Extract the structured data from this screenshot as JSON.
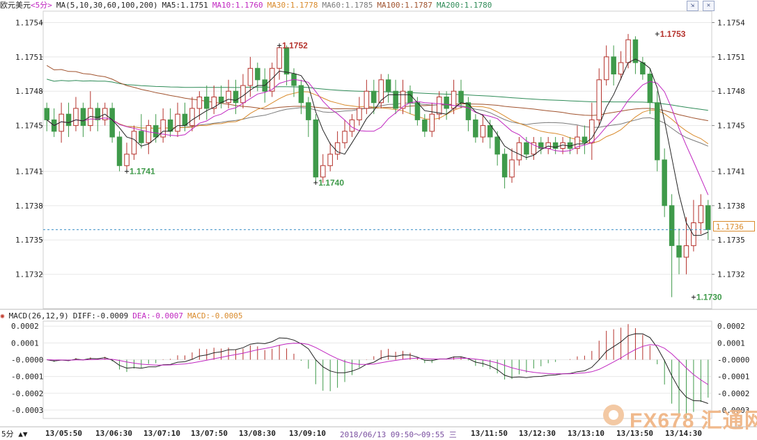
{
  "header": {
    "symbol": "欧元美元",
    "period_tag": "<5分>",
    "ma_label": "MA(5,10,30,60,100,200)",
    "ma_values": [
      {
        "text": "MA5:1.1751",
        "color": "#222222"
      },
      {
        "text": "MA10:1.1760",
        "color": "#c026c0"
      },
      {
        "text": "MA30:1.1778",
        "color": "#d98a2b"
      },
      {
        "text": "MA60:1.1785",
        "color": "#7a7a7a"
      },
      {
        "text": "MA100:1.1787",
        "color": "#a0522d"
      },
      {
        "text": "MA200:1.1780",
        "color": "#2e8b57"
      }
    ]
  },
  "macd_header": {
    "label": "MACD(26,12,9)",
    "diff": "DIFF:-0.0009",
    "dea": "DEA:-0.0007",
    "macd": "MACD:-0.0005"
  },
  "period_label": "5分",
  "last_price_label": "1.1736",
  "bottom_note": "2018/06/13 09:50～09:55 三",
  "watermark": "FX678 汇通网",
  "colors": {
    "up": "#b5322c",
    "down": "#3f9a4a",
    "ma5": "#222222",
    "ma10": "#c026c0",
    "ma30": "#d98a2b",
    "ma60": "#7a7a7a",
    "ma100": "#a0522d",
    "ma200": "#2e8b57",
    "dea": "#c026c0",
    "grid": "#e8e8e8",
    "dashed": "#3a8fc6"
  },
  "chart_data": {
    "type": "candlestick",
    "price_axis": {
      "min": 1.1729,
      "max": 1.1755,
      "ticks": [
        "1.1754",
        "1.1751",
        "1.1748",
        "1.1745",
        "1.1741",
        "1.1738",
        "1.1735",
        "1.1732"
      ]
    },
    "macd_axis": {
      "min": -0.00035,
      "max": 0.00023,
      "ticks": [
        "0.0002",
        "0.0001",
        "-0.0000",
        "-0.0001",
        "-0.0002",
        "-0.0003"
      ]
    },
    "x_labels": [
      "13/05:50",
      "13/06:30",
      "13/07:10",
      "13/07:50",
      "13/08:30",
      "13/09:10",
      "13/11:50",
      "13/12:30",
      "13/13:10",
      "13/13:50",
      "13/14:30"
    ],
    "annotations": [
      {
        "text": "1.1752",
        "price": 1.1752,
        "bar": 32,
        "type": "high"
      },
      {
        "text": "1.1741",
        "price": 1.1741,
        "bar": 11,
        "type": "low"
      },
      {
        "text": "1.1740",
        "price": 1.174,
        "bar": 37,
        "type": "low"
      },
      {
        "text": "1.1753",
        "price": 1.1753,
        "bar": 84,
        "type": "high"
      },
      {
        "text": "1.1730",
        "price": 1.173,
        "bar": 89,
        "type": "low"
      }
    ],
    "last_price": 1.17359,
    "candles": [
      [
        1.17465,
        1.17455,
        1.1747,
        1.17445
      ],
      [
        1.17455,
        1.17445,
        1.17465,
        1.1744
      ],
      [
        1.17445,
        1.1746,
        1.1747,
        1.17435
      ],
      [
        1.1746,
        1.1745,
        1.1747,
        1.1744
      ],
      [
        1.1745,
        1.17465,
        1.17475,
        1.17445
      ],
      [
        1.17465,
        1.1745,
        1.1747,
        1.1744
      ],
      [
        1.1745,
        1.17465,
        1.1748,
        1.17445
      ],
      [
        1.17465,
        1.17455,
        1.1747,
        1.17445
      ],
      [
        1.17455,
        1.17465,
        1.1747,
        1.1745
      ],
      [
        1.17465,
        1.1744,
        1.1747,
        1.17435
      ],
      [
        1.1744,
        1.17415,
        1.17445,
        1.1741
      ],
      [
        1.17415,
        1.17425,
        1.17435,
        1.1741
      ],
      [
        1.17425,
        1.17445,
        1.1745,
        1.1742
      ],
      [
        1.17445,
        1.17435,
        1.1746,
        1.1743
      ],
      [
        1.17435,
        1.1745,
        1.17455,
        1.17425
      ],
      [
        1.1745,
        1.1744,
        1.1746,
        1.17435
      ],
      [
        1.1744,
        1.17455,
        1.17465,
        1.17435
      ],
      [
        1.17455,
        1.17445,
        1.17465,
        1.1744
      ],
      [
        1.17445,
        1.1746,
        1.1747,
        1.1744
      ],
      [
        1.1746,
        1.1745,
        1.1747,
        1.17445
      ],
      [
        1.1745,
        1.17465,
        1.17475,
        1.17445
      ],
      [
        1.17465,
        1.17475,
        1.1748,
        1.17455
      ],
      [
        1.17475,
        1.17465,
        1.17485,
        1.17455
      ],
      [
        1.17465,
        1.17475,
        1.17485,
        1.1746
      ],
      [
        1.17475,
        1.1747,
        1.17485,
        1.17465
      ],
      [
        1.1747,
        1.1748,
        1.1749,
        1.17465
      ],
      [
        1.1748,
        1.1747,
        1.1749,
        1.1746
      ],
      [
        1.1747,
        1.17485,
        1.17495,
        1.17465
      ],
      [
        1.17485,
        1.175,
        1.1751,
        1.17475
      ],
      [
        1.175,
        1.1749,
        1.17505,
        1.1748
      ],
      [
        1.1749,
        1.1748,
        1.175,
        1.1747
      ],
      [
        1.1748,
        1.175,
        1.17505,
        1.17475
      ],
      [
        1.175,
        1.17518,
        1.1752,
        1.1749
      ],
      [
        1.17518,
        1.17495,
        1.1752,
        1.17485
      ],
      [
        1.17495,
        1.17485,
        1.175,
        1.17475
      ],
      [
        1.17485,
        1.1747,
        1.1749,
        1.1746
      ],
      [
        1.1747,
        1.17455,
        1.17475,
        1.1744
      ],
      [
        1.17455,
        1.17405,
        1.1746,
        1.174
      ],
      [
        1.17405,
        1.17415,
        1.17425,
        1.174
      ],
      [
        1.17415,
        1.17425,
        1.17435,
        1.1741
      ],
      [
        1.17425,
        1.17435,
        1.17445,
        1.1742
      ],
      [
        1.17435,
        1.17445,
        1.17455,
        1.1743
      ],
      [
        1.17445,
        1.17455,
        1.1746,
        1.1744
      ],
      [
        1.17455,
        1.17465,
        1.17475,
        1.1745
      ],
      [
        1.17465,
        1.1748,
        1.1749,
        1.1746
      ],
      [
        1.1748,
        1.1747,
        1.1749,
        1.1746
      ],
      [
        1.1747,
        1.1749,
        1.17495,
        1.17465
      ],
      [
        1.1749,
        1.1748,
        1.17495,
        1.1747
      ],
      [
        1.1748,
        1.17465,
        1.1749,
        1.1746
      ],
      [
        1.17465,
        1.1748,
        1.1749,
        1.1746
      ],
      [
        1.1748,
        1.1747,
        1.17485,
        1.1746
      ],
      [
        1.1747,
        1.17455,
        1.17475,
        1.1745
      ],
      [
        1.17455,
        1.17445,
        1.1746,
        1.1744
      ],
      [
        1.17445,
        1.1746,
        1.1747,
        1.1744
      ],
      [
        1.1746,
        1.17475,
        1.1748,
        1.17455
      ],
      [
        1.17475,
        1.17465,
        1.1748,
        1.17455
      ],
      [
        1.17465,
        1.1748,
        1.1749,
        1.1746
      ],
      [
        1.1748,
        1.1747,
        1.1749,
        1.17465
      ],
      [
        1.1747,
        1.17455,
        1.17475,
        1.17445
      ],
      [
        1.17455,
        1.1744,
        1.1746,
        1.17435
      ],
      [
        1.1744,
        1.1745,
        1.1746,
        1.17435
      ],
      [
        1.1745,
        1.1744,
        1.17455,
        1.1743
      ],
      [
        1.1744,
        1.17425,
        1.17445,
        1.17415
      ],
      [
        1.17425,
        1.17405,
        1.1743,
        1.17395
      ],
      [
        1.17405,
        1.1742,
        1.1743,
        1.174
      ],
      [
        1.1742,
        1.17435,
        1.1744,
        1.17415
      ],
      [
        1.17435,
        1.17425,
        1.1744,
        1.1742
      ],
      [
        1.17425,
        1.17435,
        1.1744,
        1.1742
      ],
      [
        1.17435,
        1.1743,
        1.1744,
        1.17425
      ],
      [
        1.1743,
        1.17435,
        1.1744,
        1.17425
      ],
      [
        1.17435,
        1.1743,
        1.1744,
        1.17425
      ],
      [
        1.1743,
        1.17435,
        1.1744,
        1.17425
      ],
      [
        1.17435,
        1.1743,
        1.1744,
        1.17425
      ],
      [
        1.1743,
        1.1744,
        1.1745,
        1.17425
      ],
      [
        1.1744,
        1.17435,
        1.1745,
        1.17425
      ],
      [
        1.17435,
        1.17455,
        1.1747,
        1.1742
      ],
      [
        1.17455,
        1.1749,
        1.175,
        1.1745
      ],
      [
        1.1749,
        1.1751,
        1.1752,
        1.17485
      ],
      [
        1.1751,
        1.17495,
        1.1752,
        1.17485
      ],
      [
        1.17495,
        1.17505,
        1.17515,
        1.1749
      ],
      [
        1.17505,
        1.17525,
        1.1753,
        1.175
      ],
      [
        1.17525,
        1.17505,
        1.17528,
        1.17495
      ],
      [
        1.17505,
        1.17495,
        1.1751,
        1.1749
      ],
      [
        1.17495,
        1.1747,
        1.175,
        1.1746
      ],
      [
        1.1747,
        1.1742,
        1.1748,
        1.1741
      ],
      [
        1.1742,
        1.1738,
        1.1743,
        1.1737
      ],
      [
        1.1738,
        1.17345,
        1.1739,
        1.173
      ],
      [
        1.17345,
        1.17335,
        1.1736,
        1.1732
      ],
      [
        1.17335,
        1.17345,
        1.1737,
        1.1732
      ],
      [
        1.17345,
        1.17365,
        1.17385,
        1.1734
      ],
      [
        1.17365,
        1.1738,
        1.1739,
        1.17355
      ],
      [
        1.1738,
        1.17359,
        1.17385,
        1.1735
      ]
    ],
    "ma5_last": 1.1751,
    "ma10_last": 1.176,
    "ma30_last": 1.1778,
    "ma60_last": 1.1785,
    "ma100_last": 1.1787,
    "ma200_last": 1.178
  }
}
